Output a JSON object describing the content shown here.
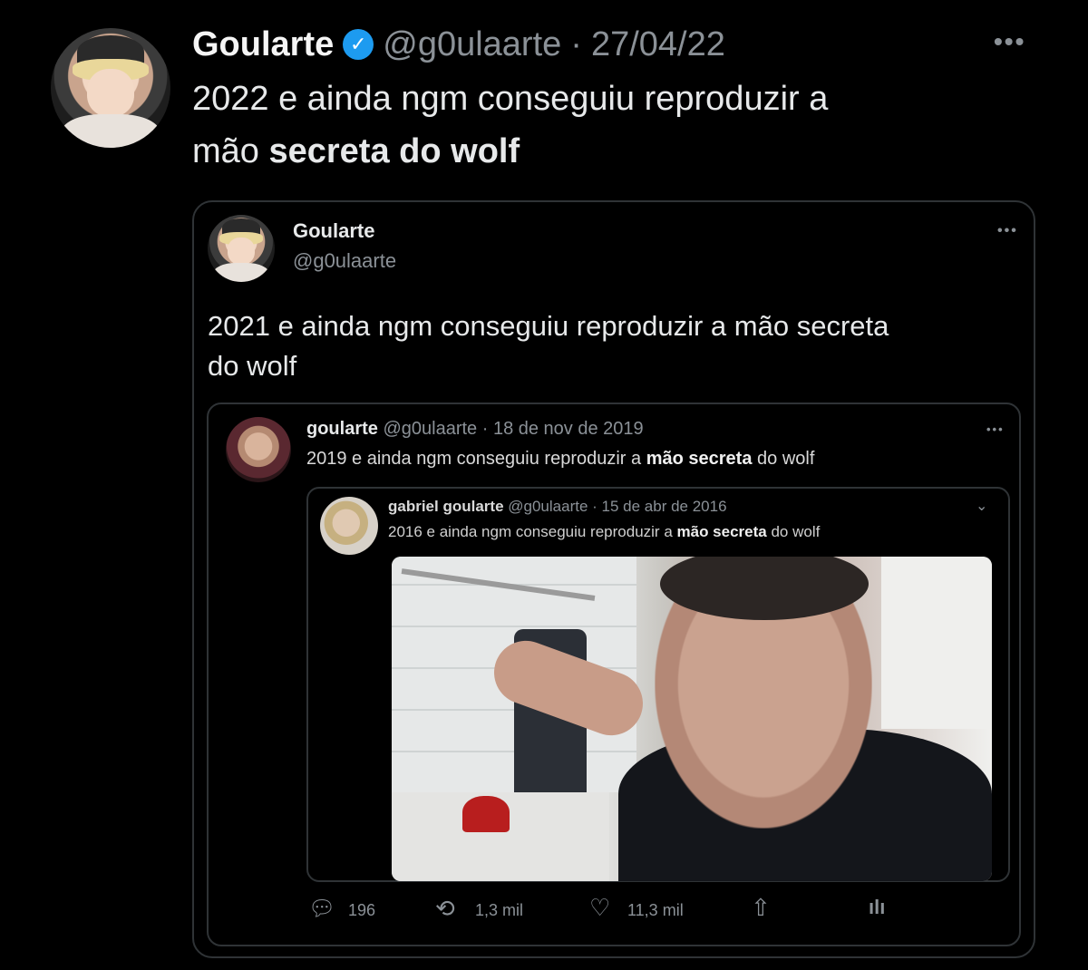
{
  "tweet": {
    "display_name": "Goularte",
    "handle": "@g0ulaarte",
    "sep": "·",
    "date": "27/04/22",
    "more_icon": "more-horizontal-icon",
    "text_normal_1": "2022 e ainda ngm conseguiu reproduzir a",
    "text_normal_2": "mão ",
    "text_bold": "secreta do wolf"
  },
  "quote1": {
    "display_name": "Goularte",
    "handle": "@g0ulaarte",
    "text_line1": "2021 e ainda ngm conseguiu reproduzir a mão secreta",
    "text_line2": "do wolf"
  },
  "quote2": {
    "display_name": "goularte",
    "handle_date": "@g0ulaarte · 18 de nov de 2019",
    "text_pre": "2019 e ainda ngm conseguiu reproduzir a ",
    "text_bold": "mão secreta",
    "text_post": " do wolf"
  },
  "quote3": {
    "display_name": "gabriel goularte",
    "handle_date": "@g0ulaarte · 15 de abr de 2016",
    "text_pre": "2016 e ainda ngm conseguiu reproduzir a ",
    "text_bold": "mão secreta",
    "text_post": " do wolf"
  },
  "actions": {
    "replies": "196",
    "retweets": "1,3 mil",
    "likes": "11,3 mil"
  }
}
